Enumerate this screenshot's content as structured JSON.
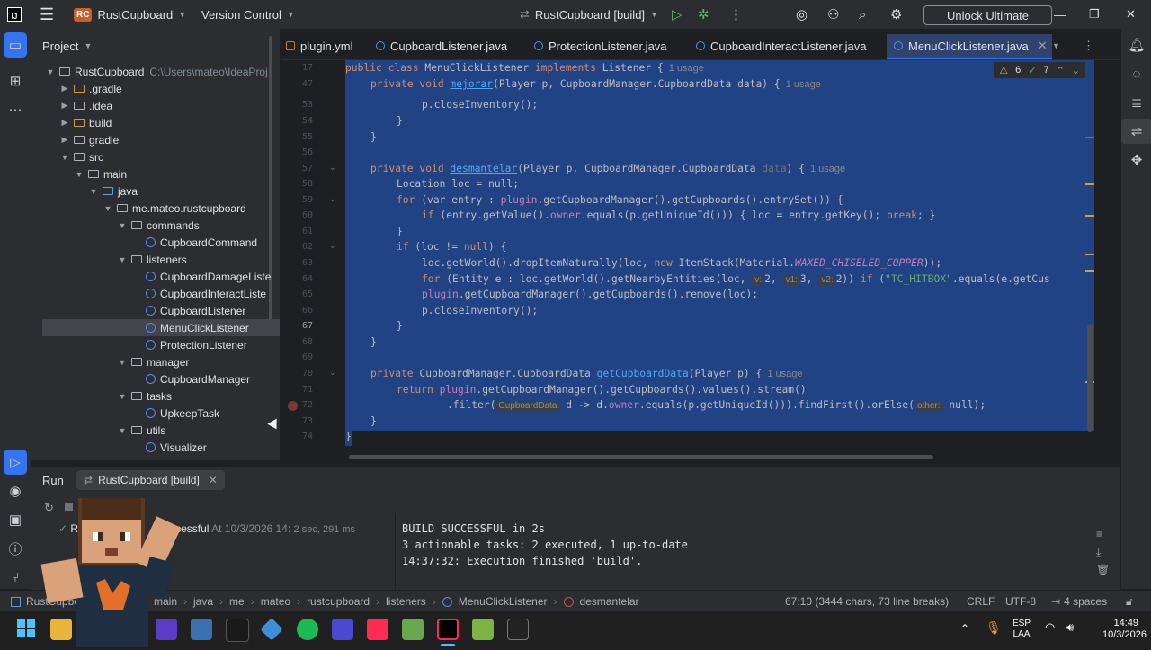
{
  "titlebar": {
    "project_badge": "RC",
    "project_name": "RustCupboard",
    "vcs_label": "Version Control",
    "run_config": "RustCupboard [build]",
    "unlock_label": "Unlock Ultimate"
  },
  "project_panel": {
    "title": "Project",
    "items": [
      {
        "label": "RustCupboard",
        "extra": "C:\\Users\\mateo\\IdeaProj"
      },
      {
        "label": ".gradle"
      },
      {
        "label": ".idea"
      },
      {
        "label": "build"
      },
      {
        "label": "gradle"
      },
      {
        "label": "src"
      },
      {
        "label": "main"
      },
      {
        "label": "java"
      },
      {
        "label": "me.mateo.rustcupboard"
      },
      {
        "label": "commands"
      },
      {
        "label": "CupboardCommand"
      },
      {
        "label": "listeners"
      },
      {
        "label": "CupboardDamageListe"
      },
      {
        "label": "CupboardInteractListe"
      },
      {
        "label": "CupboardListener"
      },
      {
        "label": "MenuClickListener"
      },
      {
        "label": "ProtectionListener"
      },
      {
        "label": "manager"
      },
      {
        "label": "CupboardManager"
      },
      {
        "label": "tasks"
      },
      {
        "label": "UpkeepTask"
      },
      {
        "label": "utils"
      },
      {
        "label": "Visualizer"
      }
    ]
  },
  "tabs": [
    {
      "label": "plugin.yml"
    },
    {
      "label": "CupboardListener.java"
    },
    {
      "label": "ProtectionListener.java"
    },
    {
      "label": "CupboardInteractListener.java"
    },
    {
      "label": "MenuClickListener.java",
      "active": true
    }
  ],
  "inspections": {
    "warnings": "6",
    "weak": "7"
  },
  "editor": {
    "line_numbers": [
      "17",
      "47",
      "53",
      "54",
      "55",
      "56",
      "57",
      "58",
      "59",
      "60",
      "61",
      "62",
      "63",
      "64",
      "65",
      "66",
      "67",
      "68",
      "69",
      "70",
      "71",
      "72",
      "73",
      "74"
    ],
    "lines": {
      "l17": {
        "a": "public class ",
        "b": "MenuClickListener ",
        "c": "implements ",
        "d": "Listener {",
        "u": "1 usage"
      },
      "l47": {
        "a": "private void ",
        "fn": "mejorar",
        "b": "(Player p, CupboardManager.CupboardData data) {",
        "u": "1 usage"
      },
      "l53": "p.closeInventory();",
      "l54": "}",
      "l55": "}",
      "l57": {
        "a": "private void ",
        "fn": "desmantelar",
        "b": "(Player p, CupboardManager.CupboardData ",
        "c": "data",
        "d": ") {",
        "u": "1 usage"
      },
      "l58": "Location loc = null;",
      "l59": {
        "a": "for ",
        "b": "(var entry : ",
        "c": "plugin",
        "d": ".getCupboardManager().getCupboards().entrySet()) {"
      },
      "l60": {
        "a": "if ",
        "b": "(entry.getValue().",
        "c": "owner",
        "d": ".equals(p.getUniqueId())) { loc = entry.getKey(); ",
        "e": "break",
        "f": "; }"
      },
      "l61": "}",
      "l62": {
        "a": "if ",
        "b": "(loc != ",
        "c": "null",
        "d": ") {"
      },
      "l63": {
        "a": "loc.getWorld().dropItemNaturally(loc, ",
        "b": "new ",
        "c": "ItemStack(Material.",
        "d": "WAXED_CHISELED_COPPER",
        "e": "));"
      },
      "l64": {
        "a": "for ",
        "b": "(Entity e : loc.getWorld().getNearbyEntities(loc, ",
        "h1": "v:",
        "n1": "2,",
        "h2": "v1:",
        "n2": "3,",
        "h3": "v2:",
        "n3": "2)) ",
        "c": "if ",
        "d": "(",
        "s": "\"TC_HITBOX\"",
        "e": ".equals(e.getCus"
      },
      "l65": {
        "a": "plugin",
        "b": ".getCupboardManager().getCupboards().remove(loc);"
      },
      "l66": "p.closeInventory();",
      "l67": "}",
      "l68": "}",
      "l70": {
        "a": "private ",
        "b": "CupboardManager.CupboardData ",
        "fn": "getCupboardData",
        "c": "(Player p) {",
        "u": "1 usage"
      },
      "l71": {
        "a": "return ",
        "b": "plugin",
        "c": ".getCupboardManager().getCupboards().values().stream()"
      },
      "l72": {
        "a": ".filter(",
        "hint": "CupboardData",
        "b": " d -> d.",
        "c": "owner",
        "d": ".equals(p.getUniqueId())).findFirst().orElse(",
        "hint2": "other:",
        "e": " null);"
      },
      "l73": "}",
      "l74": "}"
    }
  },
  "run_panel": {
    "tab_label": "Run",
    "config_tab": "RustCupboard [build]",
    "tree_status": "successful",
    "tree_prefix": "R",
    "tree_time": "At 10/3/2026 14:",
    "tree_duration": "2 sec, 291 ms",
    "console": [
      "BUILD SUCCESSFUL in 2s",
      "3 actionable tasks: 2 executed, 1 up-to-date",
      "14:37:32: Execution finished 'build'."
    ]
  },
  "statusbar": {
    "breadcrumbs": [
      "RustCupboard",
      "main",
      "java",
      "me",
      "mateo",
      "rustcupboard",
      "listeners",
      "MenuClickListener",
      "desmantelar"
    ],
    "position": "67:10 (3444 chars, 73 line breaks)",
    "line_sep": "CRLF",
    "encoding": "UTF-8",
    "indent": "4 spaces"
  },
  "taskbar": {
    "lang_top": "ESP",
    "lang_bottom": "LAA",
    "time": "14:49",
    "date": "10/3/2026"
  },
  "colors": {
    "selection": "#214283",
    "accent": "#3574f0",
    "keyword": "#cf8e6d",
    "method": "#56a8f5",
    "field": "#c77dbb",
    "string": "#6aab73"
  }
}
